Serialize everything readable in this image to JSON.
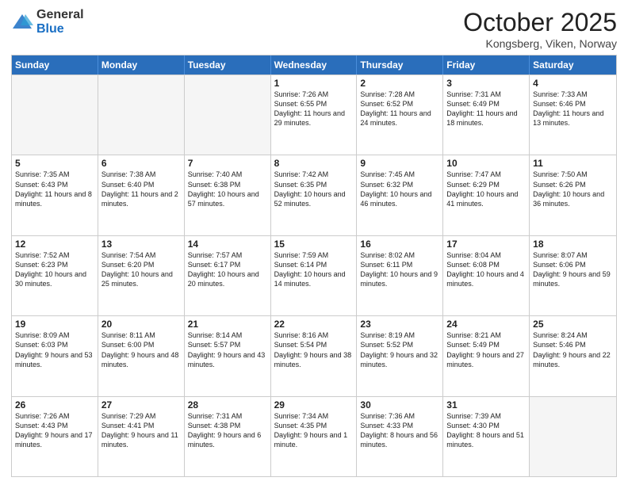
{
  "logo": {
    "general": "General",
    "blue": "Blue"
  },
  "header": {
    "month": "October 2025",
    "location": "Kongsberg, Viken, Norway"
  },
  "weekdays": [
    "Sunday",
    "Monday",
    "Tuesday",
    "Wednesday",
    "Thursday",
    "Friday",
    "Saturday"
  ],
  "rows": [
    [
      {
        "day": "",
        "sunrise": "",
        "sunset": "",
        "daylight": ""
      },
      {
        "day": "",
        "sunrise": "",
        "sunset": "",
        "daylight": ""
      },
      {
        "day": "",
        "sunrise": "",
        "sunset": "",
        "daylight": ""
      },
      {
        "day": "1",
        "sunrise": "Sunrise: 7:26 AM",
        "sunset": "Sunset: 6:55 PM",
        "daylight": "Daylight: 11 hours and 29 minutes."
      },
      {
        "day": "2",
        "sunrise": "Sunrise: 7:28 AM",
        "sunset": "Sunset: 6:52 PM",
        "daylight": "Daylight: 11 hours and 24 minutes."
      },
      {
        "day": "3",
        "sunrise": "Sunrise: 7:31 AM",
        "sunset": "Sunset: 6:49 PM",
        "daylight": "Daylight: 11 hours and 18 minutes."
      },
      {
        "day": "4",
        "sunrise": "Sunrise: 7:33 AM",
        "sunset": "Sunset: 6:46 PM",
        "daylight": "Daylight: 11 hours and 13 minutes."
      }
    ],
    [
      {
        "day": "5",
        "sunrise": "Sunrise: 7:35 AM",
        "sunset": "Sunset: 6:43 PM",
        "daylight": "Daylight: 11 hours and 8 minutes."
      },
      {
        "day": "6",
        "sunrise": "Sunrise: 7:38 AM",
        "sunset": "Sunset: 6:40 PM",
        "daylight": "Daylight: 11 hours and 2 minutes."
      },
      {
        "day": "7",
        "sunrise": "Sunrise: 7:40 AM",
        "sunset": "Sunset: 6:38 PM",
        "daylight": "Daylight: 10 hours and 57 minutes."
      },
      {
        "day": "8",
        "sunrise": "Sunrise: 7:42 AM",
        "sunset": "Sunset: 6:35 PM",
        "daylight": "Daylight: 10 hours and 52 minutes."
      },
      {
        "day": "9",
        "sunrise": "Sunrise: 7:45 AM",
        "sunset": "Sunset: 6:32 PM",
        "daylight": "Daylight: 10 hours and 46 minutes."
      },
      {
        "day": "10",
        "sunrise": "Sunrise: 7:47 AM",
        "sunset": "Sunset: 6:29 PM",
        "daylight": "Daylight: 10 hours and 41 minutes."
      },
      {
        "day": "11",
        "sunrise": "Sunrise: 7:50 AM",
        "sunset": "Sunset: 6:26 PM",
        "daylight": "Daylight: 10 hours and 36 minutes."
      }
    ],
    [
      {
        "day": "12",
        "sunrise": "Sunrise: 7:52 AM",
        "sunset": "Sunset: 6:23 PM",
        "daylight": "Daylight: 10 hours and 30 minutes."
      },
      {
        "day": "13",
        "sunrise": "Sunrise: 7:54 AM",
        "sunset": "Sunset: 6:20 PM",
        "daylight": "Daylight: 10 hours and 25 minutes."
      },
      {
        "day": "14",
        "sunrise": "Sunrise: 7:57 AM",
        "sunset": "Sunset: 6:17 PM",
        "daylight": "Daylight: 10 hours and 20 minutes."
      },
      {
        "day": "15",
        "sunrise": "Sunrise: 7:59 AM",
        "sunset": "Sunset: 6:14 PM",
        "daylight": "Daylight: 10 hours and 14 minutes."
      },
      {
        "day": "16",
        "sunrise": "Sunrise: 8:02 AM",
        "sunset": "Sunset: 6:11 PM",
        "daylight": "Daylight: 10 hours and 9 minutes."
      },
      {
        "day": "17",
        "sunrise": "Sunrise: 8:04 AM",
        "sunset": "Sunset: 6:08 PM",
        "daylight": "Daylight: 10 hours and 4 minutes."
      },
      {
        "day": "18",
        "sunrise": "Sunrise: 8:07 AM",
        "sunset": "Sunset: 6:06 PM",
        "daylight": "Daylight: 9 hours and 59 minutes."
      }
    ],
    [
      {
        "day": "19",
        "sunrise": "Sunrise: 8:09 AM",
        "sunset": "Sunset: 6:03 PM",
        "daylight": "Daylight: 9 hours and 53 minutes."
      },
      {
        "day": "20",
        "sunrise": "Sunrise: 8:11 AM",
        "sunset": "Sunset: 6:00 PM",
        "daylight": "Daylight: 9 hours and 48 minutes."
      },
      {
        "day": "21",
        "sunrise": "Sunrise: 8:14 AM",
        "sunset": "Sunset: 5:57 PM",
        "daylight": "Daylight: 9 hours and 43 minutes."
      },
      {
        "day": "22",
        "sunrise": "Sunrise: 8:16 AM",
        "sunset": "Sunset: 5:54 PM",
        "daylight": "Daylight: 9 hours and 38 minutes."
      },
      {
        "day": "23",
        "sunrise": "Sunrise: 8:19 AM",
        "sunset": "Sunset: 5:52 PM",
        "daylight": "Daylight: 9 hours and 32 minutes."
      },
      {
        "day": "24",
        "sunrise": "Sunrise: 8:21 AM",
        "sunset": "Sunset: 5:49 PM",
        "daylight": "Daylight: 9 hours and 27 minutes."
      },
      {
        "day": "25",
        "sunrise": "Sunrise: 8:24 AM",
        "sunset": "Sunset: 5:46 PM",
        "daylight": "Daylight: 9 hours and 22 minutes."
      }
    ],
    [
      {
        "day": "26",
        "sunrise": "Sunrise: 7:26 AM",
        "sunset": "Sunset: 4:43 PM",
        "daylight": "Daylight: 9 hours and 17 minutes."
      },
      {
        "day": "27",
        "sunrise": "Sunrise: 7:29 AM",
        "sunset": "Sunset: 4:41 PM",
        "daylight": "Daylight: 9 hours and 11 minutes."
      },
      {
        "day": "28",
        "sunrise": "Sunrise: 7:31 AM",
        "sunset": "Sunset: 4:38 PM",
        "daylight": "Daylight: 9 hours and 6 minutes."
      },
      {
        "day": "29",
        "sunrise": "Sunrise: 7:34 AM",
        "sunset": "Sunset: 4:35 PM",
        "daylight": "Daylight: 9 hours and 1 minute."
      },
      {
        "day": "30",
        "sunrise": "Sunrise: 7:36 AM",
        "sunset": "Sunset: 4:33 PM",
        "daylight": "Daylight: 8 hours and 56 minutes."
      },
      {
        "day": "31",
        "sunrise": "Sunrise: 7:39 AM",
        "sunset": "Sunset: 4:30 PM",
        "daylight": "Daylight: 8 hours and 51 minutes."
      },
      {
        "day": "",
        "sunrise": "",
        "sunset": "",
        "daylight": ""
      }
    ]
  ]
}
